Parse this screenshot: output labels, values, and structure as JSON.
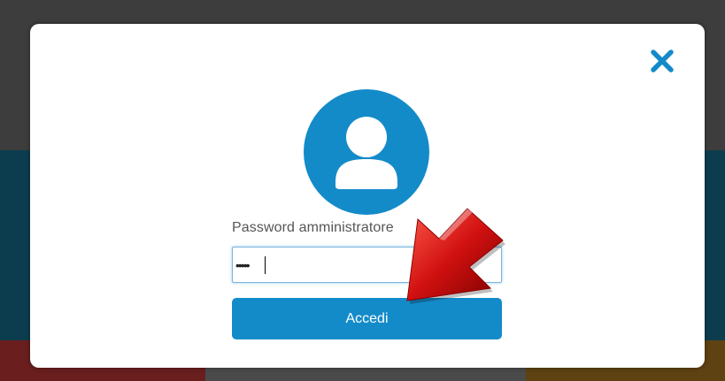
{
  "dialog": {
    "password_label": "Password amministratore",
    "password_value": "•••••",
    "login_button_label": "Accedi",
    "close_icon": "close-icon",
    "avatar_icon": "user-icon"
  },
  "colors": {
    "accent": "#148bc9",
    "arrow": "#c41212"
  }
}
